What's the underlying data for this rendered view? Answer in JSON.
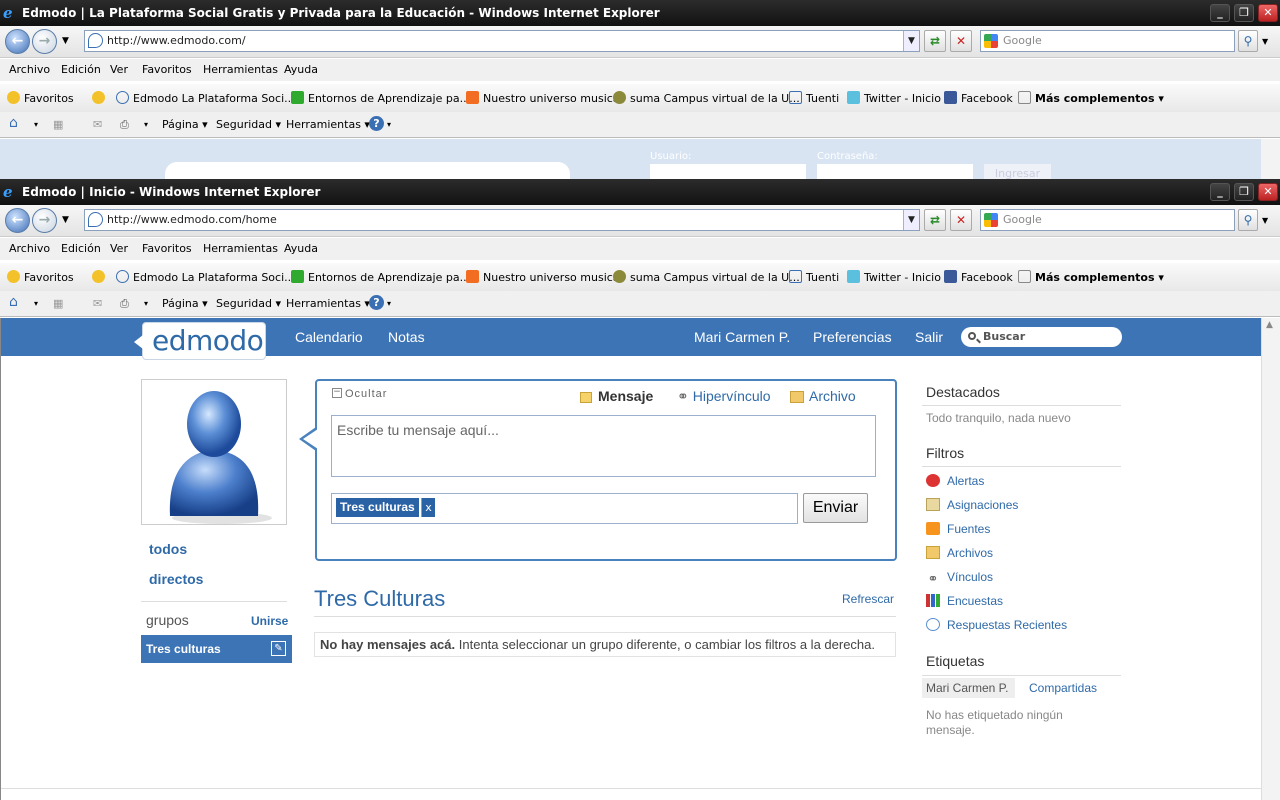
{
  "window1": {
    "title": "Edmodo | La Plataforma Social Gratis y Privada para la Educación - Windows Internet Explorer",
    "url": "http://www.edmodo.com/",
    "search_placeholder": "Google",
    "login": {
      "usuario_label": "Usuario:",
      "contrasena_label": "Contraseña:",
      "ingresar_label": "Ingresar"
    }
  },
  "window2": {
    "title": "Edmodo | Inicio - Windows Internet Explorer",
    "url": "http://www.edmodo.com/home",
    "search_placeholder": "Google"
  },
  "menu": [
    "Archivo",
    "Edición",
    "Ver",
    "Favoritos",
    "Herramientas",
    "Ayuda"
  ],
  "favorites": {
    "label": "Favoritos",
    "items": [
      "Edmodo  La Plataforma Soci...",
      "Entornos de Aprendizaje pa...",
      "Nuestro universo musical",
      "suma Campus virtual de la U...",
      "Tuenti",
      "Twitter - Inicio",
      "Facebook"
    ],
    "more": "Más complementos"
  },
  "commands": {
    "pagina": "Página",
    "seguridad": "Seguridad",
    "herramientas": "Herramientas"
  },
  "header": {
    "logo": "edmodo",
    "nav": [
      "Calendario",
      "Notas"
    ],
    "user": "Mari Carmen P.",
    "prefs": "Preferencias",
    "logout": "Salir",
    "search_placeholder": "Buscar",
    "brand_color": "#3d74b6"
  },
  "sidebar": {
    "links": [
      "todos",
      "directos"
    ],
    "groups_label": "grupos",
    "join_label": "Unirse",
    "group_item": "Tres culturas"
  },
  "composer": {
    "hide_label": "Ocultar",
    "tabs": [
      "Mensaje",
      "Hipervínculo",
      "Archivo"
    ],
    "placeholder": "Escribe tu mensaje aquí...",
    "recipient": "Tres culturas",
    "remove": "x",
    "send": "Enviar"
  },
  "feed": {
    "title": "Tres Culturas",
    "refresh": "Refrescar",
    "empty_bold": "No hay mensajes acá.",
    "empty_rest": "Intenta seleccionar un grupo diferente, o cambiar los filtros a la derecha."
  },
  "right": {
    "featured_title": "Destacados",
    "featured_text": "Todo tranquilo, nada nuevo",
    "filters_title": "Filtros",
    "filters": [
      "Alertas",
      "Asignaciones",
      "Fuentes",
      "Archivos",
      "Vínculos",
      "Encuestas",
      "Respuestas Recientes"
    ],
    "tags_title": "Etiquetas",
    "tag_tabs": [
      "Mari Carmen P.",
      "Compartidas"
    ],
    "tags_empty": "No has etiquetado ningún mensaje."
  }
}
